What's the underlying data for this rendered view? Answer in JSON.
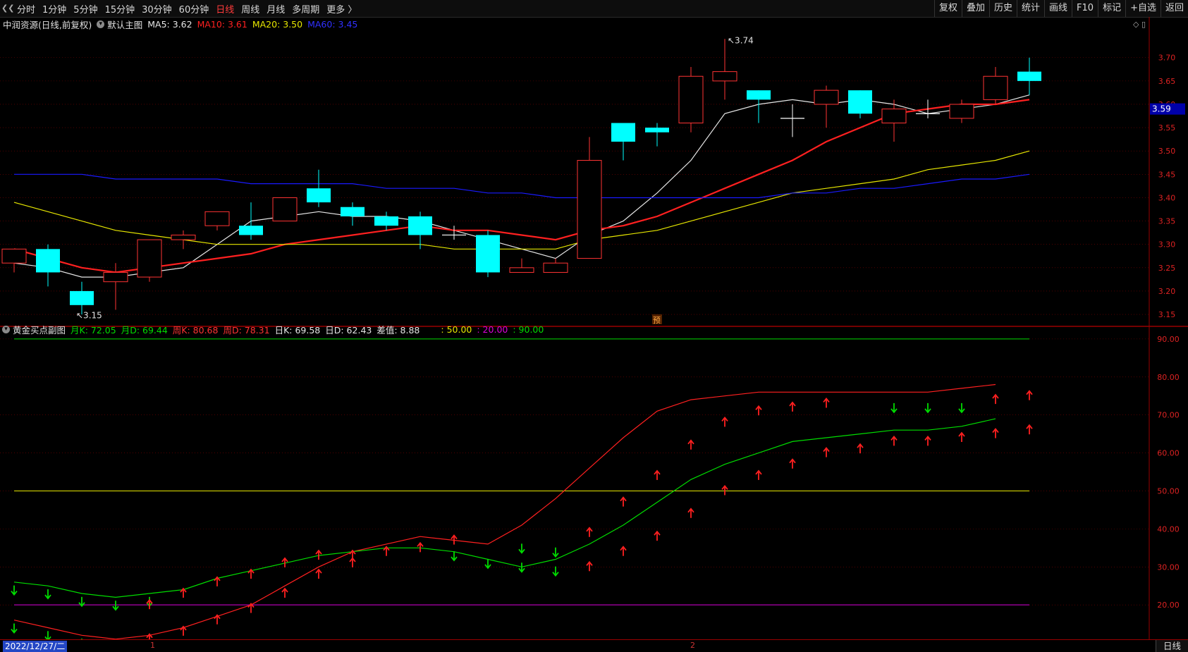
{
  "toolbar": {
    "periods": [
      "分时",
      "1分钟",
      "5分钟",
      "15分钟",
      "30分钟",
      "60分钟",
      "日线",
      "周线",
      "月线",
      "多周期",
      "更多 〉"
    ],
    "active_period": "日线",
    "right_buttons": [
      "复权",
      "叠加",
      "历史",
      "统计",
      "画线",
      "F10",
      "标记",
      "+自选",
      "返回"
    ]
  },
  "main_info": {
    "title": "中润资源(日线,前复权)",
    "main_label": "默认主图",
    "ma5": "MA5: 3.62",
    "ma10": "MA10: 3.61",
    "ma20": "MA20: 3.50",
    "ma60": "MA60: 3.45"
  },
  "sub_info": {
    "title": "黄金买点副图",
    "yk": "月K: 72.05",
    "yd": "月D: 69.44",
    "zk": "周K: 80.68",
    "zd": "周D: 78.31",
    "rk": "日K: 69.58",
    "rd": "日D: 62.43",
    "diff": "差值: 8.88",
    "l50": ": 50.00",
    "l20": ": 20.00",
    "l90": ": 90.00"
  },
  "colors": {
    "up": "#ff3333",
    "down": "#00ffff",
    "ma5": "#e6e6e6",
    "ma10": "#ff2020",
    "ma20": "#e6e600",
    "ma60": "#1a1aff",
    "green": "#00dd00",
    "magenta": "#dd00dd",
    "grid": "#800000"
  },
  "chart_data": [
    {
      "type": "candlestick",
      "title": "中润资源(日线,前复权)",
      "y_ticks": [
        "3.15",
        "3.20",
        "3.25",
        "3.30",
        "3.35",
        "3.40",
        "3.45",
        "3.50",
        "3.55",
        "3.60",
        "3.65",
        "3.70"
      ],
      "ylim": [
        3.135,
        3.76
      ],
      "current_price": "3.59",
      "high_label": "3.74",
      "low_label": "3.15",
      "pre_marker": "预",
      "candles": [
        {
          "o": 3.26,
          "h": 3.29,
          "l": 3.24,
          "c": 3.29
        },
        {
          "o": 3.29,
          "h": 3.3,
          "l": 3.21,
          "c": 3.24
        },
        {
          "o": 3.2,
          "h": 3.22,
          "l": 3.15,
          "c": 3.17
        },
        {
          "o": 3.22,
          "h": 3.26,
          "l": 3.16,
          "c": 3.24
        },
        {
          "o": 3.23,
          "h": 3.31,
          "l": 3.22,
          "c": 3.31
        },
        {
          "o": 3.31,
          "h": 3.33,
          "l": 3.29,
          "c": 3.32
        },
        {
          "o": 3.34,
          "h": 3.37,
          "l": 3.33,
          "c": 3.37
        },
        {
          "o": 3.34,
          "h": 3.39,
          "l": 3.31,
          "c": 3.32
        },
        {
          "o": 3.35,
          "h": 3.4,
          "l": 3.35,
          "c": 3.4
        },
        {
          "o": 3.42,
          "h": 3.46,
          "l": 3.38,
          "c": 3.39
        },
        {
          "o": 3.38,
          "h": 3.39,
          "l": 3.34,
          "c": 3.36
        },
        {
          "o": 3.36,
          "h": 3.37,
          "l": 3.33,
          "c": 3.34
        },
        {
          "o": 3.36,
          "h": 3.37,
          "l": 3.29,
          "c": 3.32
        },
        {
          "o": 3.32,
          "h": 3.34,
          "l": 3.31,
          "c": 3.32
        },
        {
          "o": 3.32,
          "h": 3.33,
          "l": 3.23,
          "c": 3.24
        },
        {
          "o": 3.24,
          "h": 3.27,
          "l": 3.24,
          "c": 3.25
        },
        {
          "o": 3.24,
          "h": 3.27,
          "l": 3.24,
          "c": 3.26
        },
        {
          "o": 3.27,
          "h": 3.53,
          "l": 3.27,
          "c": 3.48
        },
        {
          "o": 3.56,
          "h": 3.56,
          "l": 3.48,
          "c": 3.52
        },
        {
          "o": 3.55,
          "h": 3.56,
          "l": 3.51,
          "c": 3.54
        },
        {
          "o": 3.56,
          "h": 3.68,
          "l": 3.54,
          "c": 3.66
        },
        {
          "o": 3.65,
          "h": 3.74,
          "l": 3.61,
          "c": 3.67
        },
        {
          "o": 3.63,
          "h": 3.63,
          "l": 3.56,
          "c": 3.61
        },
        {
          "o": 3.57,
          "h": 3.6,
          "l": 3.53,
          "c": 3.57
        },
        {
          "o": 3.6,
          "h": 3.64,
          "l": 3.55,
          "c": 3.63
        },
        {
          "o": 3.63,
          "h": 3.63,
          "l": 3.57,
          "c": 3.58
        },
        {
          "o": 3.56,
          "h": 3.61,
          "l": 3.52,
          "c": 3.59
        },
        {
          "o": 3.58,
          "h": 3.61,
          "l": 3.57,
          "c": 3.58
        },
        {
          "o": 3.57,
          "h": 3.61,
          "l": 3.56,
          "c": 3.6
        },
        {
          "o": 3.61,
          "h": 3.68,
          "l": 3.6,
          "c": 3.66
        },
        {
          "o": 3.67,
          "h": 3.7,
          "l": 3.62,
          "c": 3.65
        }
      ],
      "series": [
        {
          "name": "MA5",
          "values": [
            3.26,
            3.25,
            3.23,
            3.23,
            3.24,
            3.25,
            3.3,
            3.35,
            3.36,
            3.37,
            3.36,
            3.36,
            3.35,
            3.33,
            3.31,
            3.29,
            3.27,
            3.32,
            3.35,
            3.41,
            3.48,
            3.58,
            3.6,
            3.61,
            3.6,
            3.61,
            3.6,
            3.58,
            3.59,
            3.6,
            3.62
          ]
        },
        {
          "name": "MA10",
          "values": [
            3.29,
            3.27,
            3.25,
            3.24,
            3.25,
            3.26,
            3.27,
            3.28,
            3.3,
            3.31,
            3.32,
            3.33,
            3.34,
            3.33,
            3.33,
            3.32,
            3.31,
            3.33,
            3.34,
            3.36,
            3.39,
            3.42,
            3.45,
            3.48,
            3.52,
            3.55,
            3.58,
            3.59,
            3.6,
            3.6,
            3.61
          ]
        },
        {
          "name": "MA20",
          "values": [
            3.39,
            3.37,
            3.35,
            3.33,
            3.32,
            3.31,
            3.3,
            3.3,
            3.3,
            3.3,
            3.3,
            3.3,
            3.3,
            3.29,
            3.29,
            3.29,
            3.29,
            3.31,
            3.32,
            3.33,
            3.35,
            3.37,
            3.39,
            3.41,
            3.42,
            3.43,
            3.44,
            3.46,
            3.47,
            3.48,
            3.5
          ]
        },
        {
          "name": "MA60",
          "values": [
            3.45,
            3.45,
            3.45,
            3.44,
            3.44,
            3.44,
            3.44,
            3.43,
            3.43,
            3.43,
            3.43,
            3.42,
            3.42,
            3.42,
            3.41,
            3.41,
            3.4,
            3.4,
            3.4,
            3.4,
            3.4,
            3.4,
            3.4,
            3.41,
            3.41,
            3.42,
            3.42,
            3.43,
            3.44,
            3.44,
            3.45
          ]
        }
      ]
    },
    {
      "type": "line",
      "title": "黄金买点副图",
      "y_ticks": [
        "20.00",
        "30.00",
        "40.00",
        "50.00",
        "60.00",
        "70.00",
        "80.00",
        "90.00"
      ],
      "ylim": [
        11.5,
        93.5
      ],
      "lines": [
        {
          "name": "l90",
          "value": 90
        },
        {
          "name": "l50",
          "value": 50
        },
        {
          "name": "l20",
          "value": 20
        }
      ],
      "series": [
        {
          "name": "周K",
          "values": [
            16,
            14,
            12,
            11,
            12,
            14,
            17,
            20,
            25,
            30,
            34,
            36,
            38,
            37,
            36,
            41,
            48,
            56,
            64,
            71,
            74,
            75,
            76,
            76,
            76,
            76,
            76,
            76,
            77,
            78
          ]
        },
        {
          "name": "周D",
          "values": [
            26,
            25,
            23,
            22,
            23,
            24,
            27,
            29,
            31,
            33,
            34,
            35,
            35,
            34,
            32,
            30,
            32,
            36,
            41,
            47,
            53,
            57,
            60,
            63,
            64,
            65,
            66,
            66,
            67,
            69
          ]
        }
      ],
      "arrows": [
        {
          "i": 0,
          "v": 24,
          "d": "down"
        },
        {
          "i": 0,
          "v": 14,
          "d": "down"
        },
        {
          "i": 1,
          "v": 23,
          "d": "down"
        },
        {
          "i": 1,
          "v": 12,
          "d": "down"
        },
        {
          "i": 2,
          "v": 21,
          "d": "down"
        },
        {
          "i": 2,
          "v": 10,
          "d": "down"
        },
        {
          "i": 3,
          "v": 20,
          "d": "down"
        },
        {
          "i": 3,
          "v": 9,
          "d": "down"
        },
        {
          "i": 4,
          "v": 21,
          "d": "down"
        },
        {
          "i": 4,
          "v": 20,
          "d": "up"
        },
        {
          "i": 4,
          "v": 11,
          "d": "up"
        },
        {
          "i": 5,
          "v": 23,
          "d": "up"
        },
        {
          "i": 5,
          "v": 13,
          "d": "up"
        },
        {
          "i": 6,
          "v": 26,
          "d": "up"
        },
        {
          "i": 6,
          "v": 16,
          "d": "up"
        },
        {
          "i": 7,
          "v": 28,
          "d": "up"
        },
        {
          "i": 7,
          "v": 19,
          "d": "up"
        },
        {
          "i": 8,
          "v": 31,
          "d": "up"
        },
        {
          "i": 8,
          "v": 23,
          "d": "up"
        },
        {
          "i": 9,
          "v": 33,
          "d": "up"
        },
        {
          "i": 9,
          "v": 28,
          "d": "up"
        },
        {
          "i": 10,
          "v": 33,
          "d": "up"
        },
        {
          "i": 10,
          "v": 31,
          "d": "up"
        },
        {
          "i": 11,
          "v": 34,
          "d": "up"
        },
        {
          "i": 12,
          "v": 35,
          "d": "up"
        },
        {
          "i": 13,
          "v": 37,
          "d": "up"
        },
        {
          "i": 13,
          "v": 33,
          "d": "down"
        },
        {
          "i": 14,
          "v": 31,
          "d": "down"
        },
        {
          "i": 15,
          "v": 35,
          "d": "down"
        },
        {
          "i": 15,
          "v": 30,
          "d": "down"
        },
        {
          "i": 16,
          "v": 34,
          "d": "down"
        },
        {
          "i": 16,
          "v": 29,
          "d": "down"
        },
        {
          "i": 17,
          "v": 39,
          "d": "up"
        },
        {
          "i": 17,
          "v": 30,
          "d": "up"
        },
        {
          "i": 18,
          "v": 47,
          "d": "up"
        },
        {
          "i": 18,
          "v": 34,
          "d": "up"
        },
        {
          "i": 19,
          "v": 54,
          "d": "up"
        },
        {
          "i": 19,
          "v": 38,
          "d": "up"
        },
        {
          "i": 20,
          "v": 62,
          "d": "up"
        },
        {
          "i": 20,
          "v": 44,
          "d": "up"
        },
        {
          "i": 21,
          "v": 68,
          "d": "up"
        },
        {
          "i": 21,
          "v": 50,
          "d": "up"
        },
        {
          "i": 22,
          "v": 71,
          "d": "up"
        },
        {
          "i": 22,
          "v": 54,
          "d": "up"
        },
        {
          "i": 23,
          "v": 72,
          "d": "up"
        },
        {
          "i": 23,
          "v": 57,
          "d": "up"
        },
        {
          "i": 24,
          "v": 73,
          "d": "up"
        },
        {
          "i": 24,
          "v": 60,
          "d": "up"
        },
        {
          "i": 25,
          "v": 61,
          "d": "up"
        },
        {
          "i": 26,
          "v": 72,
          "d": "down"
        },
        {
          "i": 26,
          "v": 63,
          "d": "up"
        },
        {
          "i": 27,
          "v": 72,
          "d": "down"
        },
        {
          "i": 27,
          "v": 63,
          "d": "up"
        },
        {
          "i": 28,
          "v": 72,
          "d": "down"
        },
        {
          "i": 28,
          "v": 64,
          "d": "up"
        },
        {
          "i": 29,
          "v": 74,
          "d": "up"
        },
        {
          "i": 29,
          "v": 65,
          "d": "up"
        },
        {
          "i": 30,
          "v": 75,
          "d": "up"
        },
        {
          "i": 30,
          "v": 66,
          "d": "up"
        }
      ]
    }
  ],
  "bottom": {
    "date": "2022/12/27/二",
    "mark1": "1",
    "mark2": "2",
    "period": "日线"
  },
  "corner_icons": "◇ ▯"
}
